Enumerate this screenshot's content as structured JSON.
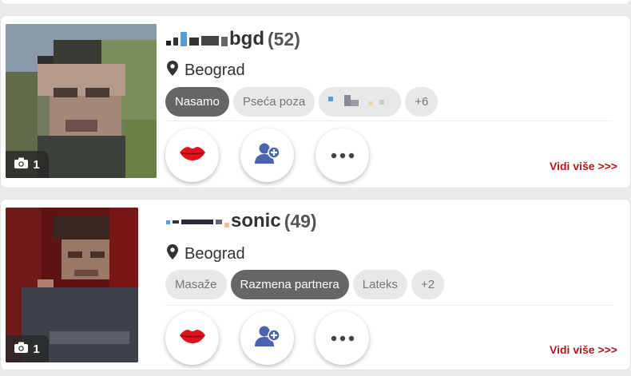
{
  "profiles": [
    {
      "username_suffix": "bgd",
      "age": "(52)",
      "location": "Beograd",
      "photo_count": "1",
      "tags": [
        "Nasamo",
        "Pseća poza",
        "+6"
      ],
      "active_tag": "Nasamo",
      "more_link": "Vidi više >>>"
    },
    {
      "username_suffix": "sonic",
      "age": "(49)",
      "location": "Beograd",
      "photo_count": "1",
      "tags": [
        "Masaže",
        "Razmena partnera",
        "Lateks",
        "+2"
      ],
      "active_tag": "Razmena partnera",
      "more_link": "Vidi više >>>"
    }
  ],
  "icons": {
    "location": "map-pin-icon",
    "camera": "camera-icon",
    "kiss": "lips-icon",
    "add_friend": "add-user-icon",
    "more": "ellipsis-icon"
  },
  "colors": {
    "accent_red": "#b8151c",
    "active_tag": "#666666",
    "tag_bg": "#e8e8e8"
  }
}
